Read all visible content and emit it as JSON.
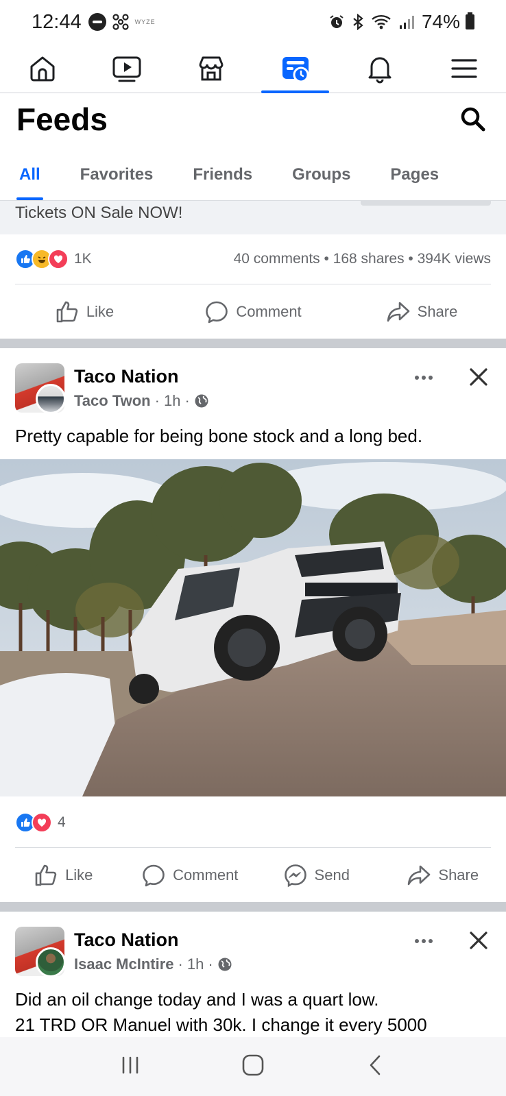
{
  "status_bar": {
    "time": "12:44",
    "app_label": "WYZE",
    "battery": "74%"
  },
  "nav": {
    "items": [
      {
        "icon": "home-icon"
      },
      {
        "icon": "video-icon"
      },
      {
        "icon": "marketplace-icon"
      },
      {
        "icon": "feeds-icon",
        "active": true
      },
      {
        "icon": "notifications-icon"
      },
      {
        "icon": "menu-icon"
      }
    ]
  },
  "header": {
    "title": "Feeds"
  },
  "filter_tabs": [
    {
      "label": "All",
      "active": true
    },
    {
      "label": "Favorites"
    },
    {
      "label": "Friends"
    },
    {
      "label": "Groups"
    },
    {
      "label": "Pages"
    }
  ],
  "prev_post": {
    "text": "Tickets ON Sale NOW!",
    "reaction_count": "1K",
    "stats": "40 comments • 168 shares • 394K views",
    "actions": {
      "like": "Like",
      "comment": "Comment",
      "share": "Share"
    }
  },
  "post1": {
    "group": "Taco Nation",
    "author": "Taco Twon",
    "time": "1h",
    "sep": "·",
    "text": "Pretty capable for being bone stock and a long bed.",
    "reaction_count": "4",
    "actions": {
      "like": "Like",
      "comment": "Comment",
      "send": "Send",
      "share": "Share"
    }
  },
  "post2": {
    "group": "Taco Nation",
    "author": "Isaac McIntire",
    "time": "1h",
    "sep": "·",
    "text_line1": "Did an oil change today and I was a quart low.",
    "text_line2": "21 TRD OR Manuel with 30k. I change it every 5000"
  },
  "colors": {
    "accent": "#0866ff",
    "secondary_text": "#65676b",
    "separator": "#c9ccd1"
  }
}
